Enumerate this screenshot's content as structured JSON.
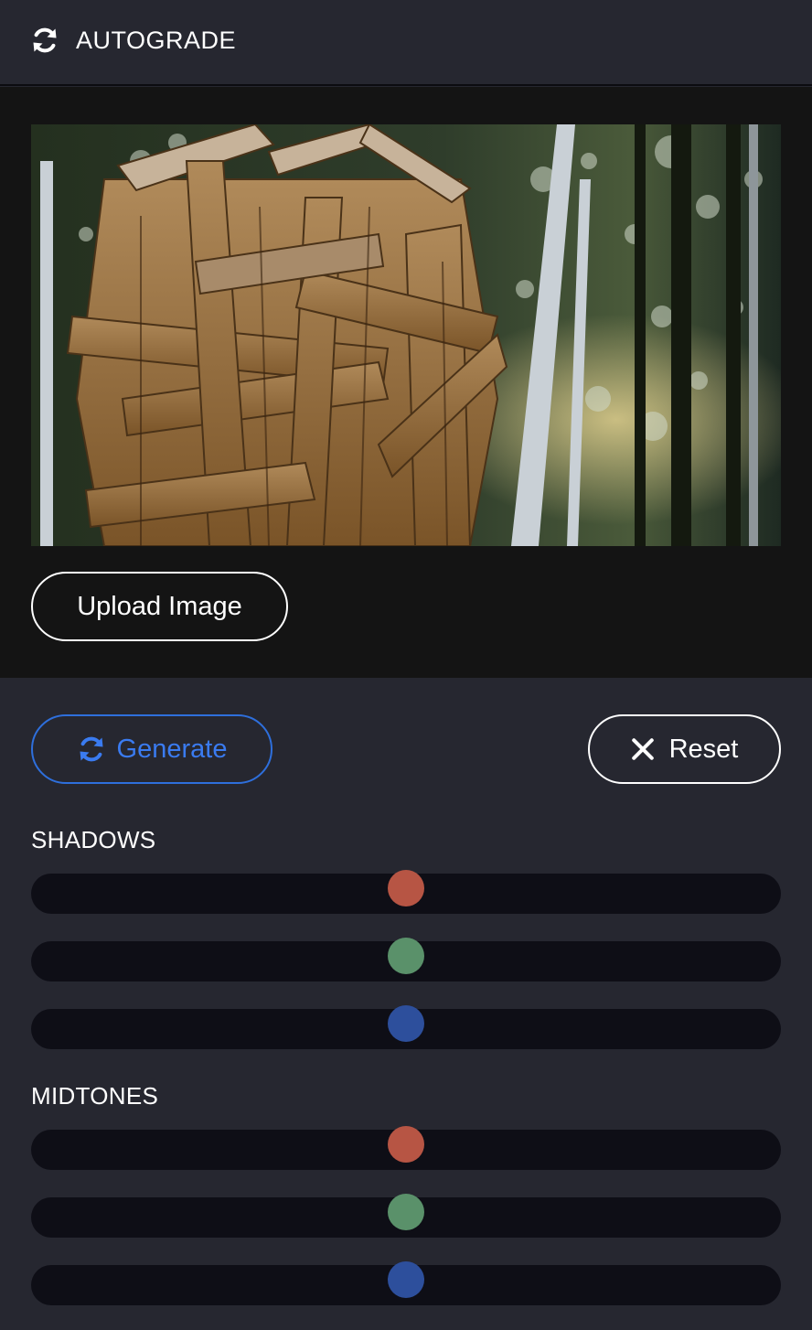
{
  "header": {
    "title": "AUTOGRADE",
    "icon": "refresh-icon"
  },
  "image_panel": {
    "photo_alt": "",
    "upload_label": "Upload Image"
  },
  "actions": {
    "generate_label": "Generate",
    "generate_icon": "refresh-icon",
    "reset_label": "Reset",
    "reset_icon": "close-icon"
  },
  "colors": {
    "accent": "#3a7bf0",
    "red_knob": "#b75544",
    "green_knob": "#5a916a",
    "blue_knob": "#2d4f9c",
    "track": "#0e0e16"
  },
  "sections": [
    {
      "label": "SHADOWS",
      "sliders": [
        {
          "channel": "red",
          "value": 0.5
        },
        {
          "channel": "green",
          "value": 0.5
        },
        {
          "channel": "blue",
          "value": 0.5
        }
      ]
    },
    {
      "label": "MIDTONES",
      "sliders": [
        {
          "channel": "red",
          "value": 0.5
        },
        {
          "channel": "green",
          "value": 0.5
        },
        {
          "channel": "blue",
          "value": 0.5
        }
      ]
    }
  ]
}
